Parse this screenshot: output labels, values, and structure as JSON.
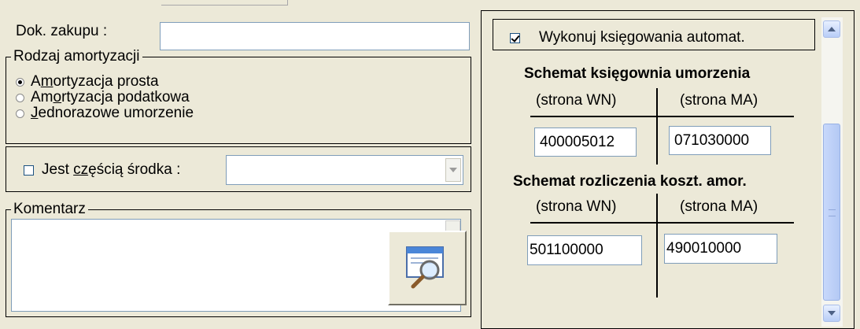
{
  "left_panel": {
    "dok_zakupu": {
      "label": "Dok. zakupu  :",
      "value": ""
    },
    "rodzaj_amortyzacji": {
      "legend": "Rodzaj amortyzacji",
      "options": [
        {
          "pre": "A",
          "underline": "m",
          "post": "ortyzacja prosta",
          "selected": true
        },
        {
          "pre": "Am",
          "underline": "o",
          "post": "rtyzacja podatkowa",
          "selected": false
        },
        {
          "pre": "",
          "underline": "J",
          "post": "ednorazowe umorzenie",
          "selected": false
        }
      ]
    },
    "czesc_srodka": {
      "pre": "Jest ",
      "underline": "cz",
      "post": "ęścią środka :",
      "checked": false,
      "value": ""
    },
    "komentarz": {
      "legend": "Komentarz",
      "value": ""
    },
    "icons": {
      "preview": "magnifier-window-icon"
    }
  },
  "right_panel": {
    "auto_posting": {
      "label": "Wykonuj księgowania automat.",
      "checked": true
    },
    "schemat_umorzenia": {
      "title": "Schemat księgownia umorzenia",
      "col_wn": "(strona WN)",
      "col_ma": "(strona MA)",
      "wn_value": "400005012",
      "ma_value": "071030000"
    },
    "schemat_kosztow": {
      "title": "Schemat rozliczenia koszt. amor.",
      "col_wn": "(strona WN)",
      "col_ma": "(strona MA)",
      "wn_value": "501100000",
      "ma_value": "490010000"
    }
  }
}
